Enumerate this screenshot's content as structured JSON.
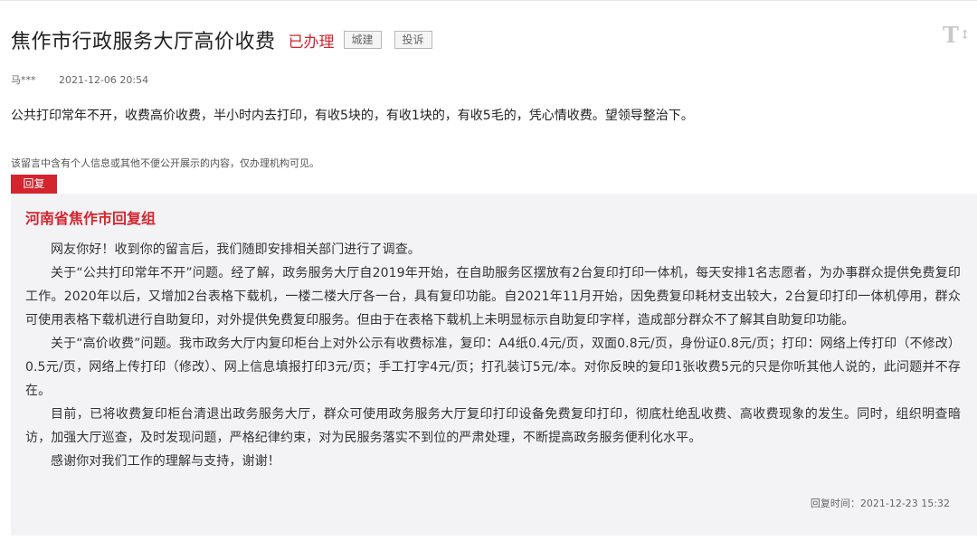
{
  "header": {
    "title": "焦作市行政服务大厅高价收费",
    "status": "已办理",
    "tags": [
      "城建",
      "投诉"
    ],
    "font_size_icon": "T↕"
  },
  "meta": {
    "author": "马***",
    "time": "2021-12-06 20:54"
  },
  "message": {
    "content": "公共打印常年不开，收费高价收费，半小时内去打印，有收5块的，有收1块的，有收5毛的，凭心情收费。望领导整治下。",
    "privacy_note": "该留言中含有个人信息或其他不便公开展示的内容，仅办理机构可见。"
  },
  "reply": {
    "tab_label": "回复",
    "org_name": "河南省焦作市回复组",
    "paragraphs": [
      "网友你好！收到你的留言后，我们随即安排相关部门进行了调查。",
      "关于“公共打印常年不开”问题。经了解，政务服务大厅自2019年开始，在自助服务区摆放有2台复印打印一体机，每天安排1名志愿者，为办事群众提供免费复印工作。2020年以后，又增加2台表格下载机，一楼二楼大厅各一台，具有复印功能。自2021年11月开始，因免费复印耗材支出较大，2台复印打印一体机停用，群众可使用表格下载机进行自助复印，对外提供免费复印服务。但由于在表格下载机上未明显标示自助复印字样，造成部分群众不了解其自助复印功能。",
      "关于“高价收费”问题。我市政务大厅内复印柜台上对外公示有收费标准，复印：A4纸0.4元/页，双面0.8元/页，身份证0.8元/页；打印：网络上传打印（不修改）0.5元/页，网络上传打印（修改）、网上信息填报打印3元/页；手工打字4元/页；打孔装订5元/本。对你反映的复印1张收费5元的只是你听其他人说的，此问题并不存在。",
      "目前，已将收费复印柜台清退出政务服务大厅，群众可使用政务服务大厅复印打印设备免费复印打印，彻底杜绝乱收费、高收费现象的发生。同时，组织明查暗访，加强大厅巡查，及时发现问题，严格纪律约束，对为民服务落实不到位的严肃处理，不断提高政务服务便利化水平。",
      "感谢你对我们工作的理解与支持，谢谢！"
    ],
    "time": "回复时间：2021-12-23 15:32"
  }
}
